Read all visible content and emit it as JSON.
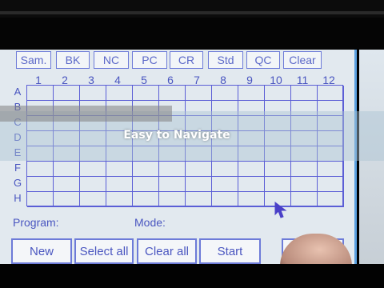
{
  "tabs": [
    "Sam.",
    "BK",
    "NC",
    "PC",
    "CR",
    "Std",
    "QC",
    "Clear"
  ],
  "columns": [
    "1",
    "2",
    "3",
    "4",
    "5",
    "6",
    "7",
    "8",
    "9",
    "10",
    "11",
    "12"
  ],
  "rows": [
    "A",
    "B",
    "C",
    "D",
    "E",
    "F",
    "G",
    "H"
  ],
  "fields": {
    "program_label": "Program:",
    "mode_label": "Mode:"
  },
  "buttons": {
    "new": "New",
    "select_all": "Select all",
    "clear_all": "Clear all",
    "start": "Start",
    "hidden": ""
  },
  "overlay": {
    "caption": "Easy to Navigate"
  },
  "colors": {
    "accent": "#5b5ed6",
    "screen": "#e2e9ef",
    "label": "#4a56c0"
  }
}
